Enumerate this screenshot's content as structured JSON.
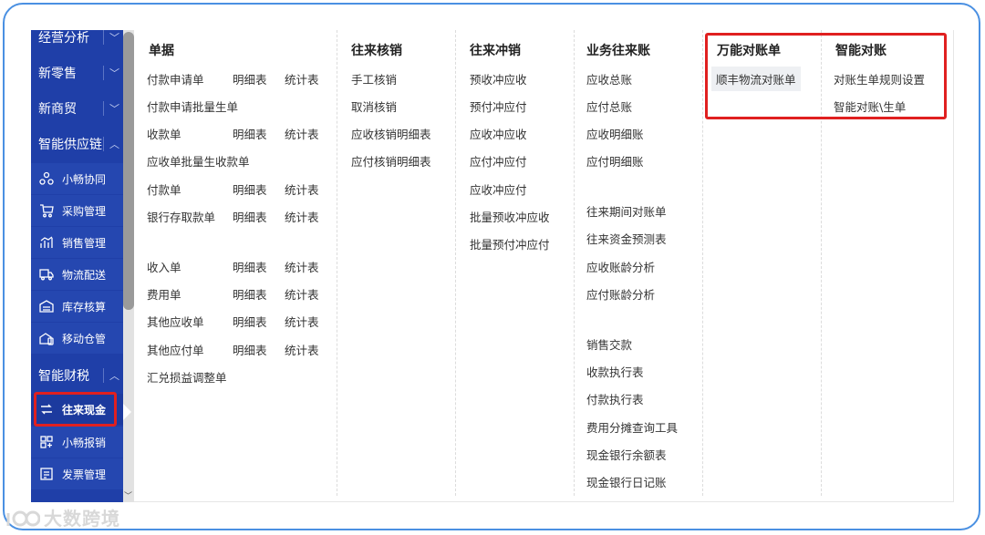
{
  "sidebar": {
    "groups": [
      {
        "label": "经营分析",
        "chevron": "﹀"
      },
      {
        "label": "新零售",
        "chevron": "﹀"
      },
      {
        "label": "新商贸",
        "chevron": "﹀"
      },
      {
        "label": "智能供应链",
        "chevron": "︿"
      }
    ],
    "supply_items": [
      {
        "label": "小畅协同",
        "icon": "collab-icon"
      },
      {
        "label": "采购管理",
        "icon": "cart-icon"
      },
      {
        "label": "销售管理",
        "icon": "chart-icon"
      },
      {
        "label": "物流配送",
        "icon": "truck-icon"
      },
      {
        "label": "库存核算",
        "icon": "warehouse-icon"
      },
      {
        "label": "移动仓管",
        "icon": "mobile-warehouse-icon"
      }
    ],
    "tax_group": {
      "label": "智能财税",
      "chevron": "︿"
    },
    "tax_items": [
      {
        "label": "往来现金",
        "icon": "exchange-icon"
      },
      {
        "label": "小畅报销",
        "icon": "grid-icon"
      },
      {
        "label": "发票管理",
        "icon": "invoice-icon"
      }
    ]
  },
  "menu": {
    "documents": {
      "title": "单据",
      "rows": [
        {
          "main": "付款申请单",
          "detail": "明细表",
          "stats": "统计表"
        },
        {
          "main": "付款申请批量生单",
          "detail": "",
          "stats": ""
        },
        {
          "main": "收款单",
          "detail": "明细表",
          "stats": "统计表"
        },
        {
          "main": "应收单批量生收款单",
          "detail": "",
          "stats": ""
        },
        {
          "main": "付款单",
          "detail": "明细表",
          "stats": "统计表"
        },
        {
          "main": "银行存取款单",
          "detail": "明细表",
          "stats": "统计表"
        },
        {
          "main": "收入单",
          "detail": "明细表",
          "stats": "统计表"
        },
        {
          "main": "费用单",
          "detail": "明细表",
          "stats": "统计表"
        },
        {
          "main": "其他应收单",
          "detail": "明细表",
          "stats": "统计表"
        },
        {
          "main": "其他应付单",
          "detail": "明细表",
          "stats": "统计表"
        },
        {
          "main": "汇兑损益调整单",
          "detail": "",
          "stats": ""
        }
      ]
    },
    "writeoff": {
      "title": "往来核销",
      "items": [
        "手工核销",
        "取消核销",
        "应收核销明细表",
        "应付核销明细表"
      ]
    },
    "offset": {
      "title": "往来冲销",
      "items": [
        "预收冲应收",
        "预付冲应付",
        "应收冲应收",
        "应付冲应付",
        "应收冲应付",
        "批量预收冲应收",
        "批量预付冲应付"
      ]
    },
    "ledger": {
      "title": "业务往来账",
      "group1": [
        "应收总账",
        "应付总账",
        "应收明细账",
        "应付明细账"
      ],
      "group2": [
        "往来期间对账单",
        "往来资金预测表",
        "应收账龄分析",
        "应付账龄分析"
      ],
      "group3": [
        "销售交款",
        "收款执行表",
        "付款执行表",
        "费用分摊查询工具",
        "现金银行余额表",
        "现金银行日记账"
      ]
    },
    "universal": {
      "title": "万能对账单",
      "items": [
        "顺丰物流对账单"
      ]
    },
    "smart": {
      "title": "智能对账",
      "items": [
        "对账生单规则设置",
        "智能对账\\生单"
      ]
    }
  },
  "watermark": {
    "text": "大数跨境"
  }
}
